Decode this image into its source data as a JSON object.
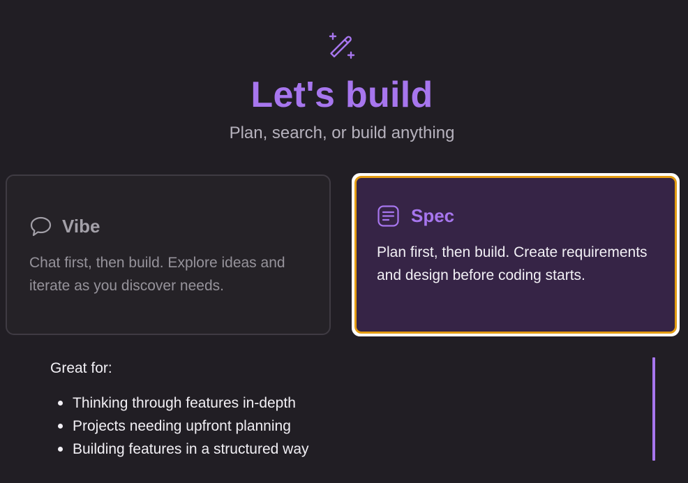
{
  "header": {
    "icon": "magic-wand-icon",
    "title": "Let's build",
    "subtitle": "Plan, search, or build anything"
  },
  "modes": {
    "vibe": {
      "icon": "chat-bubble-icon",
      "title": "Vibe",
      "description": "Chat first, then build. Explore ideas and iterate as you discover needs.",
      "selected": false
    },
    "spec": {
      "icon": "document-list-icon",
      "title": "Spec",
      "description": "Plan first, then build. Create requirements and design before coding starts.",
      "selected": true
    }
  },
  "details": {
    "heading": "Great for:",
    "items": [
      "Thinking through features in-depth",
      "Projects needing upfront planning",
      "Building features in a structured way"
    ]
  },
  "colors": {
    "background": "#211e24",
    "accent": "#a776ee",
    "selected_border": "#e39c12",
    "selected_card": "#362446",
    "unselected_card": "#252227"
  }
}
